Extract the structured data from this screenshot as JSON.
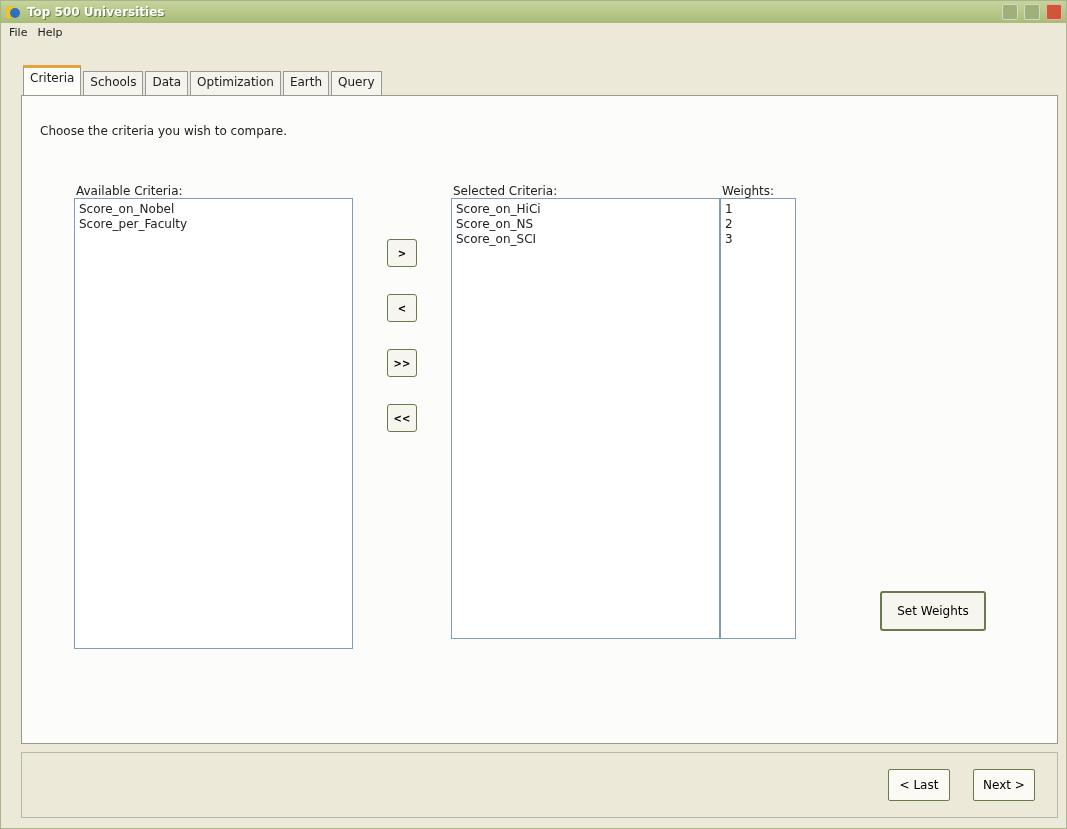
{
  "window": {
    "title": "Top 500 Universities"
  },
  "menu": [
    "File",
    "Help"
  ],
  "tabs": [
    {
      "label": "Criteria",
      "selected": true
    },
    {
      "label": "Schools",
      "selected": false
    },
    {
      "label": "Data",
      "selected": false
    },
    {
      "label": "Optimization",
      "selected": false
    },
    {
      "label": "Earth",
      "selected": false
    },
    {
      "label": "Query",
      "selected": false
    }
  ],
  "instruction": "Choose the criteria you wish to compare.",
  "available": {
    "label": "Available Criteria:",
    "items": [
      "Score_on_Nobel",
      "Score_per_Faculty"
    ]
  },
  "move_buttons": [
    ">",
    "<",
    ">>",
    "<<"
  ],
  "selected_criteria": {
    "label": "Selected Criteria:",
    "items": [
      "Score_on_HiCi",
      "Score_on_NS",
      "Score_on_SCI"
    ]
  },
  "weights": {
    "label": "Weights:",
    "items": [
      "1",
      "2",
      "3"
    ]
  },
  "set_weights_button": "Set Weights",
  "nav_buttons": [
    "< Last",
    "Next >"
  ]
}
